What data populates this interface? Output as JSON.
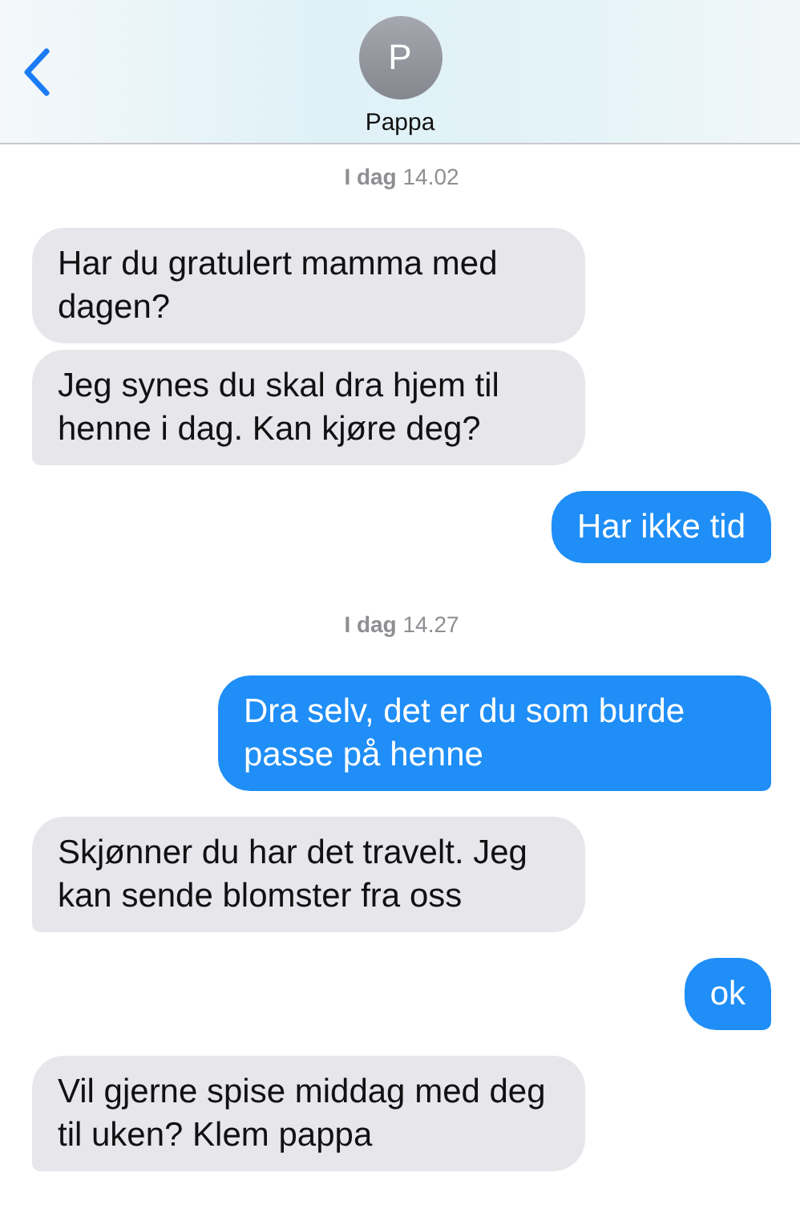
{
  "header": {
    "contact": {
      "initial": "P",
      "name": "Pappa"
    }
  },
  "thread": [
    {
      "kind": "timestamp",
      "text": "**I dag** 14.02"
    },
    {
      "kind": "message",
      "outgoing": false,
      "tail": false,
      "text": "Har du gratulert mamma med dagen?"
    },
    {
      "kind": "message",
      "outgoing": false,
      "tail": true,
      "text": "Jeg synes du skal dra hjem til henne i dag. Kan kjøre deg?"
    },
    {
      "kind": "message",
      "outgoing": true,
      "tail": true,
      "text": "Har ikke tid"
    },
    {
      "kind": "timestamp",
      "text": "**I dag** 14.27"
    },
    {
      "kind": "message",
      "outgoing": true,
      "tail": true,
      "text": "Dra selv, det er du som burde passe på henne"
    },
    {
      "kind": "message",
      "outgoing": false,
      "tail": true,
      "text": "Skjønner du har det travelt. Jeg kan sende blomster fra oss"
    },
    {
      "kind": "message",
      "outgoing": true,
      "tail": true,
      "text": "ok"
    },
    {
      "kind": "message",
      "outgoing": false,
      "tail": true,
      "text": "Vil gjerne spise middag med deg til uken? Klem pappa"
    }
  ]
}
